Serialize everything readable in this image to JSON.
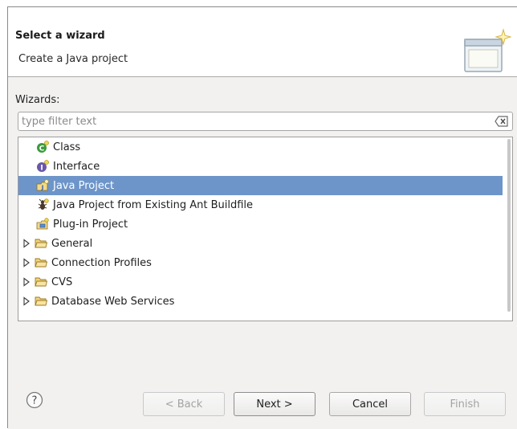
{
  "banner": {
    "title": "Select a wizard",
    "description": "Create a Java project",
    "icon": "wizard-banner-icon"
  },
  "wizards_label": "Wizards:",
  "filter": {
    "value": "",
    "placeholder": "type filter text",
    "clear_icon": "clear-filter-icon"
  },
  "tree": {
    "items": [
      {
        "label": "Class",
        "icon": "java-class-icon",
        "type": "leaf",
        "selected": false
      },
      {
        "label": "Interface",
        "icon": "java-interface-icon",
        "type": "leaf",
        "selected": false
      },
      {
        "label": "Java Project",
        "icon": "java-project-icon",
        "type": "leaf",
        "selected": true
      },
      {
        "label": "Java Project from Existing Ant Buildfile",
        "icon": "ant-buildfile-icon",
        "type": "leaf",
        "selected": false
      },
      {
        "label": "Plug-in Project",
        "icon": "plugin-project-icon",
        "type": "leaf",
        "selected": false
      },
      {
        "label": "General",
        "icon": "folder-icon",
        "type": "folder",
        "selected": false
      },
      {
        "label": "Connection Profiles",
        "icon": "folder-icon",
        "type": "folder",
        "selected": false
      },
      {
        "label": "CVS",
        "icon": "folder-icon",
        "type": "folder",
        "selected": false
      },
      {
        "label": "Database Web Services",
        "icon": "folder-icon",
        "type": "folder",
        "selected": false
      }
    ],
    "selection_color": "#6d95c9"
  },
  "buttons": {
    "help_icon": "help-icon",
    "back": "< Back",
    "next": "Next >",
    "cancel": "Cancel",
    "finish": "Finish"
  }
}
